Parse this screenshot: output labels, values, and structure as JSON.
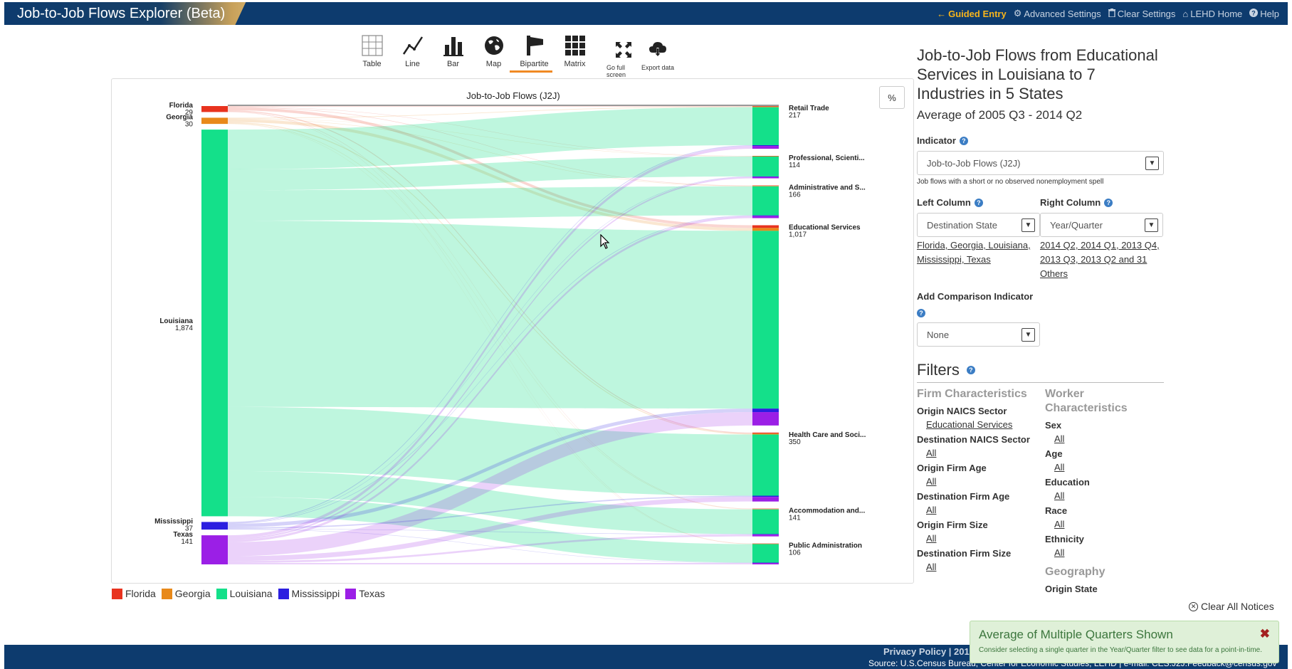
{
  "header": {
    "app_title": "Job-to-Job Flows Explorer",
    "beta_label": "(Beta)",
    "nav": [
      {
        "label": "Guided Entry",
        "icon": "arrow-left-icon"
      },
      {
        "label": "Advanced Settings",
        "icon": "gear-icon"
      },
      {
        "label": "Clear Settings",
        "icon": "trash-icon"
      },
      {
        "label": "LEHD Home",
        "icon": "home-icon"
      },
      {
        "label": "Help",
        "icon": "question-icon"
      }
    ]
  },
  "toolbar": {
    "views": [
      {
        "label": "Table",
        "icon": "table-icon"
      },
      {
        "label": "Line",
        "icon": "line-chart-icon"
      },
      {
        "label": "Bar",
        "icon": "bar-chart-icon"
      },
      {
        "label": "Map",
        "icon": "globe-icon"
      },
      {
        "label": "Bipartite",
        "icon": "bipartite-icon",
        "active": true
      },
      {
        "label": "Matrix",
        "icon": "matrix-icon"
      }
    ],
    "actions": [
      {
        "label": "Go full screen",
        "icon": "fullscreen-icon"
      },
      {
        "label": "Export data",
        "icon": "download-cloud-icon"
      }
    ]
  },
  "chart": {
    "percent_button": "%"
  },
  "chart_data": {
    "type": "bipartite",
    "title": "Job-to-Job Flows (J2J)",
    "left_nodes": [
      {
        "name": "Florida",
        "value": 29,
        "color": "#e8331f"
      },
      {
        "name": "Georgia",
        "value": 30,
        "color": "#e8891a"
      },
      {
        "name": "Louisiana",
        "value": 1874,
        "color": "#14e08a"
      },
      {
        "name": "Mississippi",
        "value": 37,
        "color": "#2c1fe0"
      },
      {
        "name": "Texas",
        "value": 141,
        "color": "#9b1fe6"
      }
    ],
    "right_nodes": [
      {
        "name": "Retail Trade",
        "value": 217
      },
      {
        "name": "Professional, Scienti...",
        "value": 114
      },
      {
        "name": "Administrative and S...",
        "value": 166
      },
      {
        "name": "Educational Services",
        "value": "1,017"
      },
      {
        "name": "Health Care and Soci...",
        "value": 350
      },
      {
        "name": "Accommodation and...",
        "value": 141
      },
      {
        "name": "Public Administration",
        "value": 106
      }
    ],
    "left_value_labels": [
      "29",
      "30",
      "1,874",
      "37",
      "141"
    ],
    "legend": [
      "Florida",
      "Georgia",
      "Louisiana",
      "Mississippi",
      "Texas"
    ]
  },
  "side": {
    "title": "Job-to-Job Flows from Educational Services in Louisiana to 7 Industries in 5 States",
    "subtitle": "Average of 2005 Q3 - 2014 Q2",
    "indicator_label": "Indicator",
    "indicator_value": "Job-to-Job Flows (J2J)",
    "indicator_note": "Job flows with a short or no observed nonemployment spell",
    "left_column_label": "Left Column",
    "left_column_value": "Destination State",
    "left_column_links": [
      "Florida, Georgia, Louisiana,",
      "Mississippi, Texas"
    ],
    "right_column_label": "Right Column",
    "right_column_value": "Year/Quarter",
    "right_column_links": [
      "2014 Q2, 2014 Q1, 2013 Q4,",
      "2013 Q3, 2013 Q2 and 31",
      "Others"
    ],
    "comparison_label": "Add Comparison Indicator",
    "comparison_value": "None",
    "filters_title": "Filters",
    "firm_head": "Firm Characteristics",
    "worker_head": "Worker Characteristics",
    "geo_head": "Geography",
    "firm_filters": [
      {
        "label": "Origin NAICS Sector",
        "value": "Educational Services"
      },
      {
        "label": "Destination NAICS Sector",
        "value": "All"
      },
      {
        "label": "Origin Firm Age",
        "value": "All"
      },
      {
        "label": "Destination Firm Age",
        "value": "All"
      },
      {
        "label": "Origin Firm Size",
        "value": "All"
      },
      {
        "label": "Destination Firm Size",
        "value": "All"
      }
    ],
    "worker_filters": [
      {
        "label": "Sex",
        "value": "All"
      },
      {
        "label": "Age",
        "value": "All"
      },
      {
        "label": "Education",
        "value": "All"
      },
      {
        "label": "Race",
        "value": "All"
      },
      {
        "label": "Ethnicity",
        "value": "All"
      }
    ],
    "geo_first": "Origin State"
  },
  "notices": {
    "clear_all": "Clear All Notices",
    "title": "Average of Multiple Quarters Shown",
    "text": "Consider selecting a single quarter in the Year/Quarter filter to see data for a point-in-time.",
    "close": "✖"
  },
  "footer": {
    "links": "Privacy Policy | 2010",
    "source": "Source: U.S.Census Bureau, Center for Economic Studies, LEHD  |  e-mail: CES.J2J.Feedback@census.gov"
  }
}
